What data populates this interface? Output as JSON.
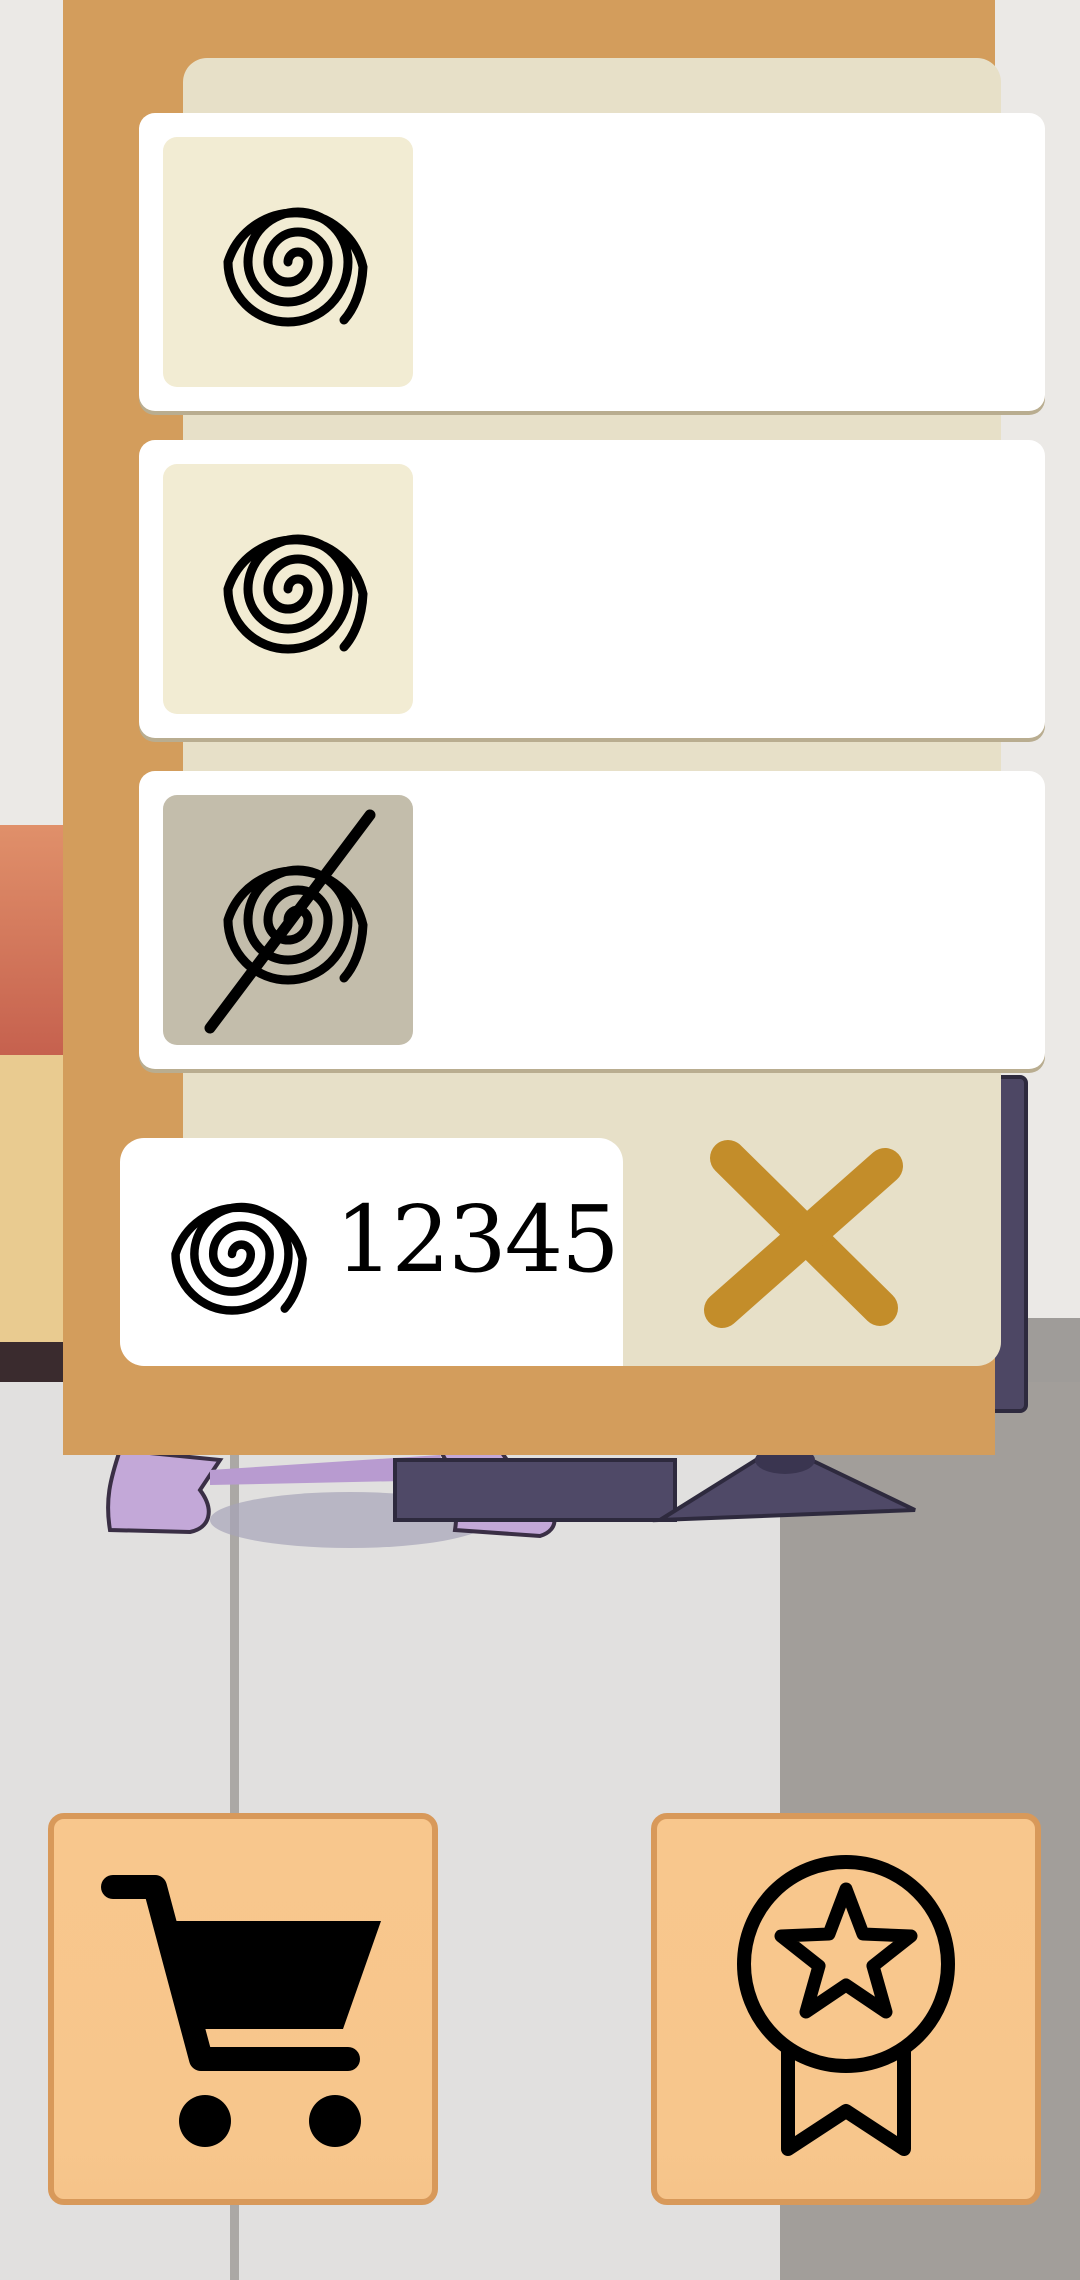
{
  "currency": {
    "icon": "spiral-icon",
    "value": "12345"
  },
  "items": [
    {
      "icon": "spiral-icon",
      "state": "available"
    },
    {
      "icon": "spiral-icon",
      "state": "available"
    },
    {
      "icon": "spiral-crossed-icon",
      "state": "locked"
    }
  ],
  "buttons": {
    "close": "close-icon",
    "shop": "shopping-cart-icon",
    "achievements": "award-ribbon-icon"
  },
  "colors": {
    "panel": "#d39d5c",
    "panel_inner": "#e7e0c8",
    "close_x": "#c38d2a",
    "button_fill": "#f8c78d"
  }
}
